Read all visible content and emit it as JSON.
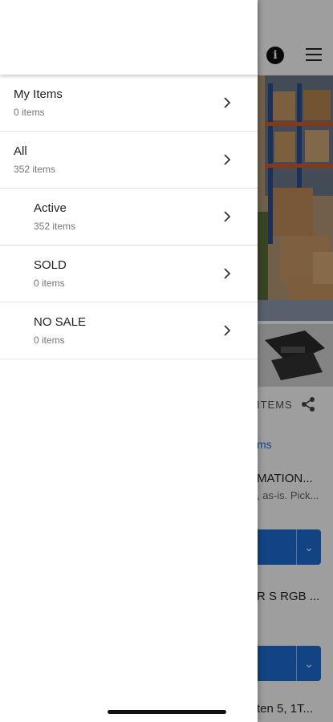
{
  "drawer": {
    "items": [
      {
        "title": "My Items",
        "count": "0 items"
      },
      {
        "title": "All",
        "count": "352 items"
      },
      {
        "title": "Active",
        "count": "352 items"
      },
      {
        "title": "SOLD",
        "count": "0 items"
      },
      {
        "title": "NO SALE",
        "count": "0 items"
      }
    ]
  },
  "background": {
    "items_label": "ITEMS",
    "items_link": "ms",
    "cards": [
      {
        "title": "MATION...",
        "subtitle": ", as-is. Pick..."
      },
      {
        "title": "R S RGB ...",
        "subtitle": ""
      },
      {
        "title": "ten 5, 1T...",
        "subtitle": ""
      }
    ]
  },
  "colors": {
    "accent": "#1e6fd6",
    "scrim": "rgba(0,0,0,0.38)"
  },
  "icons": {
    "info": "info-icon",
    "menu": "menu-icon",
    "share": "share-icon",
    "chevron": "chevron-right-icon"
  }
}
